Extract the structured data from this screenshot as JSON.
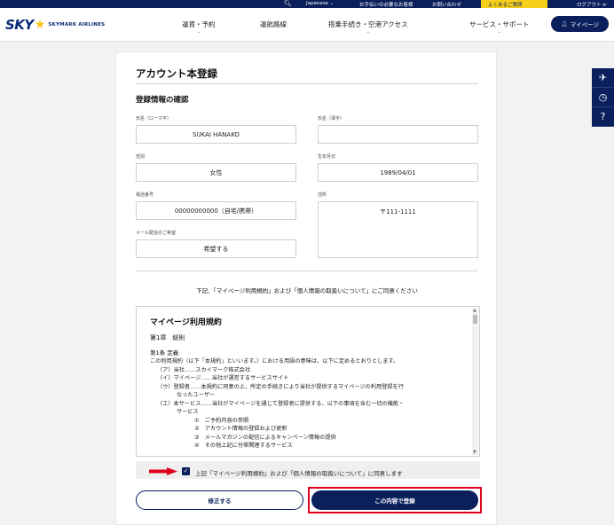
{
  "topbar": {
    "search_icon": "search-icon",
    "language": "Japanese ⌄",
    "contact_request": "お手伝いの必要なお客様",
    "contact": "お問い合わせ",
    "faq": "よくあるご質問",
    "logout": "ログアウト ⊳"
  },
  "header": {
    "logo_sky": "SKY",
    "logo_name": "SKYMARK AIRLINES",
    "nav": [
      "運賃・予約",
      "運航路線",
      "搭乗手続き・空港アクセス",
      "サービス・サポート"
    ],
    "mypage_label": "マイページ"
  },
  "side_tabs": [
    "plane-icon",
    "clock-icon",
    "help-icon"
  ],
  "side_help": "?",
  "form": {
    "page_title": "アカウント本登録",
    "section_title": "登録情報の確認",
    "fields": {
      "name_roman": {
        "label": "氏名（ローマ字）",
        "value": "SUKAI HANAKO"
      },
      "name_kanji": {
        "label": "氏名（漢字）",
        "value": ""
      },
      "gender": {
        "label": "性別",
        "value": "女性"
      },
      "birthdate": {
        "label": "生年月日",
        "value": "1989/04/01"
      },
      "phone": {
        "label": "電話番号",
        "value": "00000000000（自宅/携帯）"
      },
      "address": {
        "label": "住所",
        "value": "〒111-1111"
      },
      "mail_delivery": {
        "label": "メール配信のご希望",
        "value": "希望する"
      }
    },
    "agreement_lead": "下記、「マイページ利用規約」および「個人情報の取扱いについて」にご同意ください"
  },
  "terms": {
    "title": "マイページ利用規約",
    "chapter": "第1章　総則",
    "article": "第1条 定義",
    "lines": [
      "この利用規約（以下「本規約」といいます。）における用語の意味は、以下に定めるとおりとします。",
      "（ア）当社……スカイマーク株式会社",
      "（イ）マイページ……当社が運営するサービスサイト",
      "（ウ）登録者……本規約に同意の上、所定の手続きにより当社が提供するマイページの利用登録を行",
      "なったユーザー",
      "（エ）本サービス……当社がマイページを通じて登録者に提供する、以下の事項を含む一切の機能・",
      "サービス",
      "①　ご予約内容の参照",
      "②　アカウント情報の登録および更新",
      "③　メールマガジンの配信によるキャンペーン情報の提供",
      "④　その他上記に付帯関連するサービス"
    ]
  },
  "agree_checkbox": {
    "checked": true,
    "label": "上記「マイページ利用規約」および「個人情報の取扱いについて」に同意します"
  },
  "buttons": {
    "edit": "修正する",
    "register": "この内容で登録"
  },
  "colors": {
    "navy": "#0a1f5c",
    "highlight_red": "#e0001a",
    "faq_yellow": "#f5cf1a"
  }
}
